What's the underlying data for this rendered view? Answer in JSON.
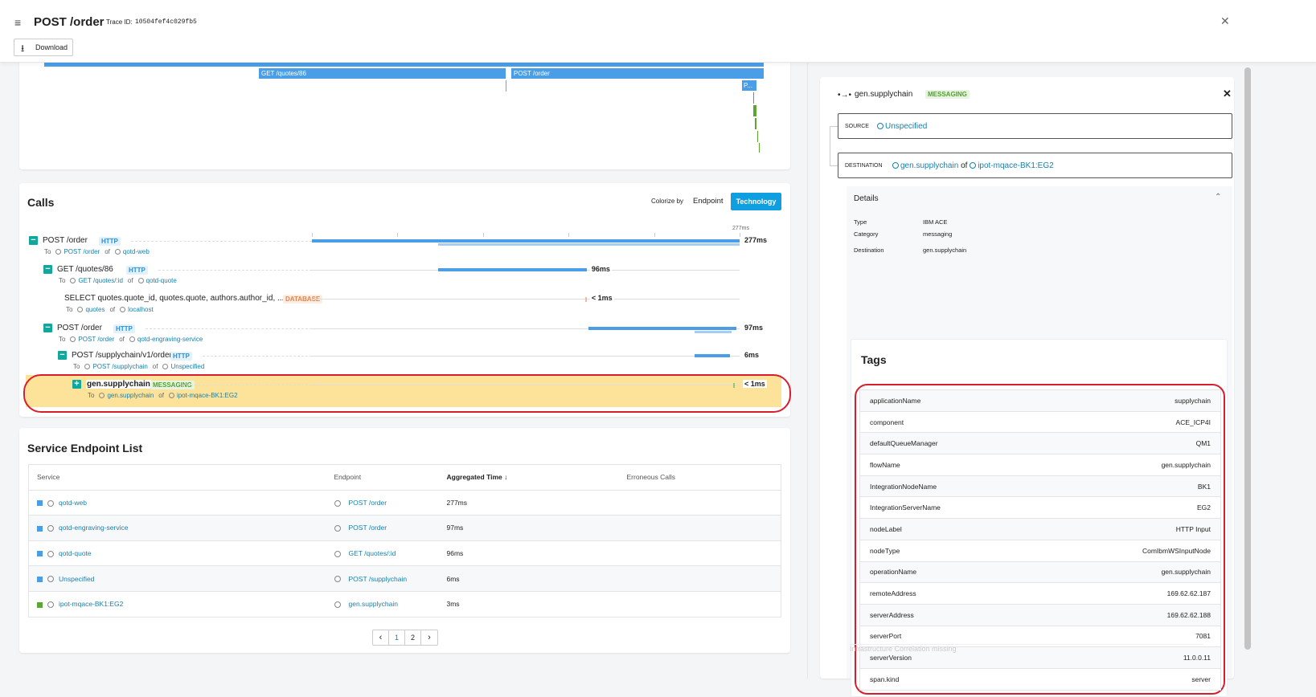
{
  "header": {
    "title": "POST /order",
    "trace_label": "Trace ID:",
    "trace_id": "10504fef4c029fb5",
    "download": "Download",
    "icon": "trace-icon"
  },
  "timeline": {
    "bars": [
      {
        "label": "GET /quotes/86"
      },
      {
        "label": "POST /order"
      },
      {
        "label": "P..."
      }
    ]
  },
  "calls": {
    "title": "Calls",
    "colorize_label": "Colorize by",
    "colorize_options": [
      "Endpoint",
      "Technology"
    ],
    "colorize_selected": "Technology",
    "axis_end": "277ms",
    "rows": [
      {
        "name": "POST /order",
        "tech": "HTTP",
        "to": "To",
        "endpoint": "POST /order",
        "of": "of",
        "service": "qotd-web",
        "duration": "277ms"
      },
      {
        "name": "GET /quotes/86",
        "tech": "HTTP",
        "to": "To",
        "endpoint": "GET /quotes/:id",
        "of": "of",
        "service": "qotd-quote",
        "duration": "96ms"
      },
      {
        "name": "SELECT quotes.quote_id, quotes.quote, authors.author_id, ...",
        "tech": "DATABASE",
        "to": "To",
        "endpoint": "quotes",
        "of": "of",
        "service": "localhost",
        "duration": "< 1ms"
      },
      {
        "name": "POST /order",
        "tech": "HTTP",
        "to": "To",
        "endpoint": "POST /order",
        "of": "of",
        "service": "qotd-engraving-service",
        "duration": "97ms"
      },
      {
        "name": "POST /supplychain/v1/order",
        "tech": "HTTP",
        "to": "To",
        "endpoint": "POST /supplychain",
        "of": "of",
        "service": "Unspecified",
        "duration": "6ms"
      },
      {
        "name": "gen.supplychain",
        "tech": "MESSAGING",
        "to": "To",
        "endpoint": "gen.supplychain",
        "of": "of",
        "service": "ipot-mqace-BK1:EG2",
        "duration": "< 1ms"
      }
    ]
  },
  "endpoints": {
    "title": "Service Endpoint List",
    "columns": [
      "Service",
      "Endpoint",
      "Aggregated Time",
      "Erroneous Calls"
    ],
    "sort_icon": "arrow-down-icon",
    "rows": [
      {
        "service": "qotd-web",
        "endpoint": "POST /order",
        "time": "277ms",
        "color": "#4a9ee8"
      },
      {
        "service": "qotd-engraving-service",
        "endpoint": "POST /order",
        "time": "97ms",
        "color": "#4a9ee8"
      },
      {
        "service": "qotd-quote",
        "endpoint": "GET /quotes/:id",
        "time": "96ms",
        "color": "#4a9ee8"
      },
      {
        "service": "Unspecified",
        "endpoint": "POST /supplychain",
        "time": "6ms",
        "color": "#4a9ee8"
      },
      {
        "service": "ipot-mqace-BK1:EG2",
        "endpoint": "gen.supplychain",
        "time": "3ms",
        "color": "#5aa832"
      }
    ],
    "pagination": {
      "pages": [
        "1",
        "2"
      ],
      "current": "1"
    }
  },
  "detail": {
    "title": "gen.supplychain",
    "badge": "MESSAGING",
    "source_label": "SOURCE",
    "source": "Unspecified",
    "dest_label": "DESTINATION",
    "dest_endpoint": "gen.supplychain",
    "dest_of": "of",
    "dest_service": "ipot-mqace-BK1:EG2",
    "details_title": "Details",
    "fields": [
      {
        "k": "Type",
        "v": "IBM ACE"
      },
      {
        "k": "Category",
        "v": "messaging"
      },
      {
        "k": "Destination",
        "v": "gen.supplychain"
      }
    ],
    "tags_title": "Tags",
    "tags": [
      {
        "k": "applicationName",
        "v": "supplychain"
      },
      {
        "k": "component",
        "v": "ACE_ICP4I"
      },
      {
        "k": "defaultQueueManager",
        "v": "QM1"
      },
      {
        "k": "flowName",
        "v": "gen.supplychain"
      },
      {
        "k": "IntegrationNodeName",
        "v": "BK1"
      },
      {
        "k": "IntegrationServerName",
        "v": "EG2"
      },
      {
        "k": "nodeLabel",
        "v": "HTTP Input"
      },
      {
        "k": "nodeType",
        "v": "ComIbmWSInputNode"
      },
      {
        "k": "operationName",
        "v": "gen.supplychain"
      },
      {
        "k": "remoteAddress",
        "v": "169.62.62.187"
      },
      {
        "k": "serverAddress",
        "v": "169.62.62.188"
      },
      {
        "k": "serverPort",
        "v": "7081"
      },
      {
        "k": "serverVersion",
        "v": "11.0.0.11"
      },
      {
        "k": "span.kind",
        "v": "server"
      }
    ],
    "footer": "Infrastructure  Correlation missing"
  },
  "colors": {
    "accent": "#0f9ee0",
    "http_bar": "#4a9ee8",
    "messaging": "#5aa832",
    "database": "#e5824a",
    "highlight": "#fde29a",
    "annotation": "#d81e2c"
  }
}
